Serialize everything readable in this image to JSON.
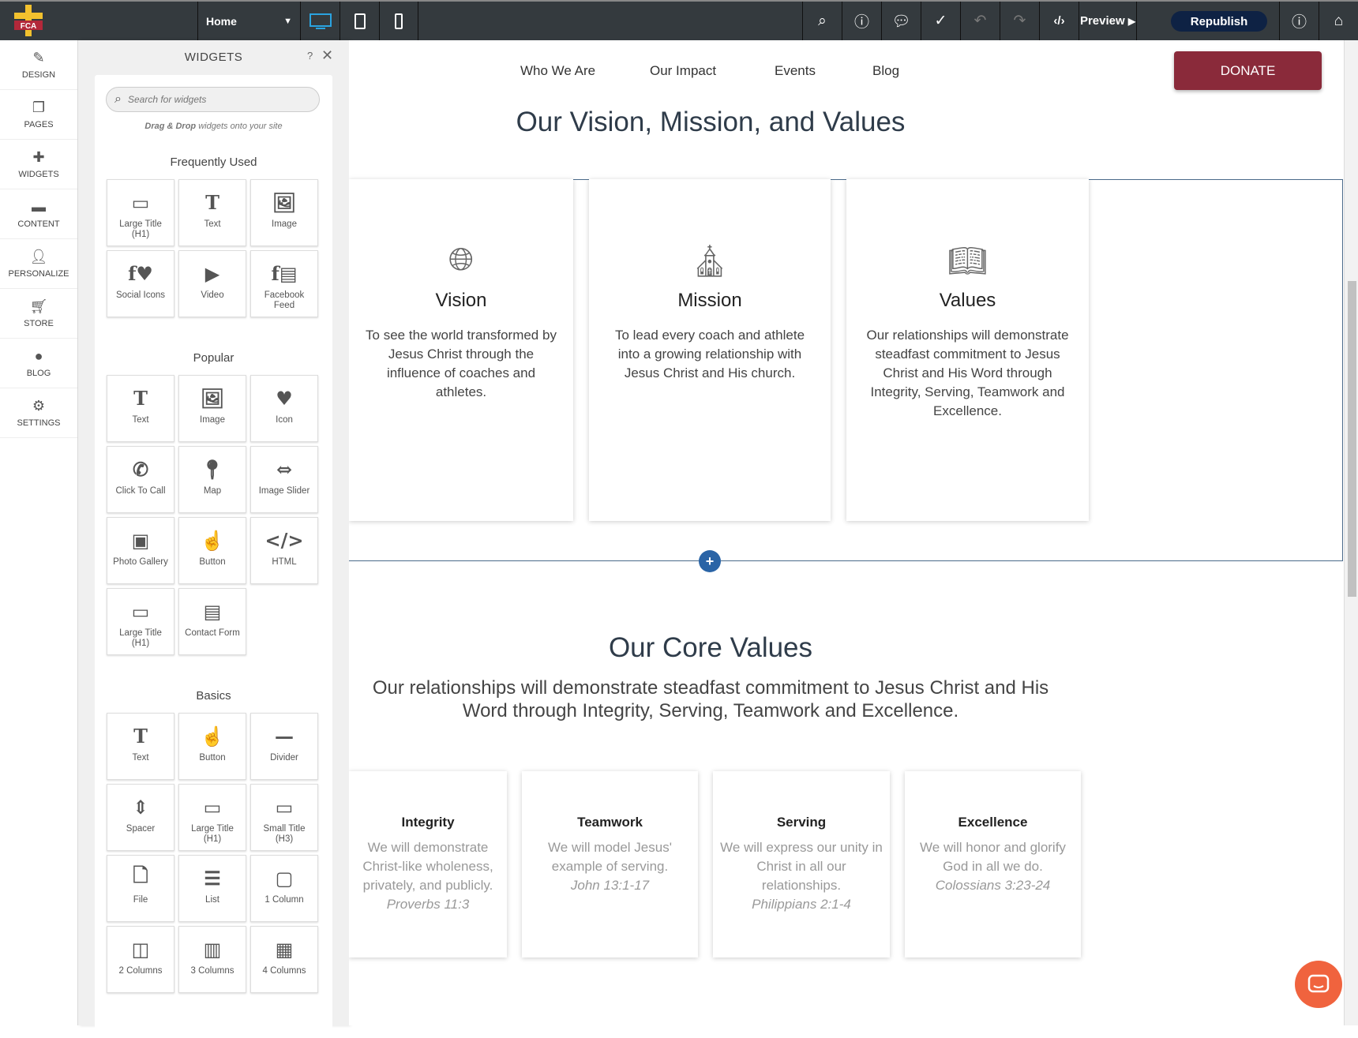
{
  "topbar": {
    "logo_text": "FCA",
    "page": "Home",
    "preview": "Preview",
    "republish": "Republish"
  },
  "rail": [
    {
      "label": "DESIGN",
      "icon": "brush-icon"
    },
    {
      "label": "PAGES",
      "icon": "pages-icon"
    },
    {
      "label": "WIDGETS",
      "icon": "plus-icon"
    },
    {
      "label": "CONTENT",
      "icon": "folder-icon"
    },
    {
      "label": "PERSONALIZE",
      "icon": "person-icon"
    },
    {
      "label": "STORE",
      "icon": "cart-icon"
    },
    {
      "label": "BLOG",
      "icon": "chat-icon"
    },
    {
      "label": "SETTINGS",
      "icon": "gear-icon"
    }
  ],
  "panel": {
    "title": "WIDGETS",
    "help": "?",
    "search_placeholder": "Search for widgets",
    "hint_bold": "Drag & Drop",
    "hint_rest": " widgets onto your site",
    "sections": [
      {
        "title": "Frequently Used",
        "items": [
          {
            "label": "Large Title (H1)",
            "icon": "title-icon"
          },
          {
            "label": "Text",
            "icon": "text-icon"
          },
          {
            "label": "Image",
            "icon": "image-icon"
          },
          {
            "label": "Social Icons",
            "icon": "social-icon"
          },
          {
            "label": "Video",
            "icon": "play-icon"
          },
          {
            "label": "Facebook Feed",
            "icon": "facebook-feed-icon"
          }
        ]
      },
      {
        "title": "Popular",
        "items": [
          {
            "label": "Text",
            "icon": "text-icon"
          },
          {
            "label": "Image",
            "icon": "image-icon"
          },
          {
            "label": "Icon",
            "icon": "heart-icon"
          },
          {
            "label": "Click To Call",
            "icon": "phone-icon"
          },
          {
            "label": "Map",
            "icon": "map-pin-icon"
          },
          {
            "label": "Image Slider",
            "icon": "slider-icon"
          },
          {
            "label": "Photo Gallery",
            "icon": "gallery-icon"
          },
          {
            "label": "Button",
            "icon": "hand-icon"
          },
          {
            "label": "HTML",
            "icon": "code-icon"
          },
          {
            "label": "Large Title (H1)",
            "icon": "title-icon"
          },
          {
            "label": "Contact Form",
            "icon": "form-icon"
          }
        ]
      },
      {
        "title": "Basics",
        "items": [
          {
            "label": "Text",
            "icon": "text-icon"
          },
          {
            "label": "Button",
            "icon": "hand-icon"
          },
          {
            "label": "Divider",
            "icon": "divider-icon"
          },
          {
            "label": "Spacer",
            "icon": "spacer-icon"
          },
          {
            "label": "Large Title (H1)",
            "icon": "title-icon"
          },
          {
            "label": "Small Title (H3)",
            "icon": "title-icon"
          },
          {
            "label": "File",
            "icon": "file-icon"
          },
          {
            "label": "List",
            "icon": "list-icon"
          },
          {
            "label": "1 Column",
            "icon": "column1-icon"
          },
          {
            "label": "2 Columns",
            "icon": "column2-icon"
          },
          {
            "label": "3 Columns",
            "icon": "column3-icon"
          },
          {
            "label": "4 Columns",
            "icon": "column4-icon"
          }
        ]
      }
    ]
  },
  "site": {
    "nav": [
      "Who We Are",
      "Our Impact",
      "Events",
      "Blog"
    ],
    "donate": "DONATE",
    "title": "Our Vision, Mission, and Values",
    "cards": [
      {
        "title": "Vision",
        "icon": "globe-icon",
        "text": "To see the world transformed by Jesus Christ through the influence of coaches and athletes."
      },
      {
        "title": "Mission",
        "icon": "church-icon",
        "text": "To lead every coach and athlete into a growing relationship with Jesus Christ and His church."
      },
      {
        "title": "Values",
        "icon": "book-icon",
        "text": "Our relationships will demonstrate steadfast commitment to Jesus Christ and His Word through Integrity, Serving, Teamwork and Excellence."
      }
    ],
    "core_title": "Our Core Values",
    "core_text": "Our relationships will demonstrate steadfast commitment to Jesus Christ and His Word through Integrity, Serving, Teamwork and Excellence.",
    "core": [
      {
        "title": "Integrity",
        "text": "We will demonstrate Christ-like wholeness, privately, and publicly.",
        "ref": "Proverbs 11:3"
      },
      {
        "title": "Teamwork",
        "text": "We will model Jesus' example of serving.",
        "ref": "John 13:1-17"
      },
      {
        "title": "Serving",
        "text": "We will express our unity in Christ in all our relationships.",
        "ref": "Philippians 2:1-4"
      },
      {
        "title": "Excellence",
        "text": "We will honor and glorify God in all we do.",
        "ref": "Colossians 3:23-24"
      }
    ]
  }
}
